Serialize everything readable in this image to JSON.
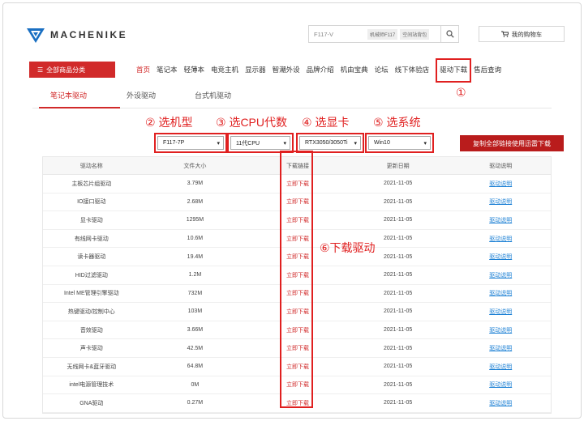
{
  "brand": {
    "name": "MACHENIKE"
  },
  "search": {
    "value": "F117-V",
    "hot_tags": [
      "机械师F117",
      "空间站背包"
    ]
  },
  "cart": {
    "label": "我的购物车"
  },
  "nav": {
    "all_categories": "全部商品分类",
    "items": [
      "首页",
      "笔记本",
      "轻薄本",
      "电竞主机",
      "显示器",
      "智潮外设",
      "品牌介绍",
      "机由宝典",
      "论坛",
      "线下体验店",
      "驱动下载",
      "售后查询"
    ]
  },
  "subtabs": [
    "笔记本驱动",
    "外设驱动",
    "台式机驱动"
  ],
  "annotations": {
    "a1": "①",
    "a2": "② 选机型",
    "a3": "③ 选CPU代数",
    "a4": "④ 选显卡",
    "a5": "⑤ 选系统",
    "a6": "⑥下载驱动"
  },
  "filters": {
    "model": "F117-7P",
    "cpu": "11代CPU",
    "gpu": "RTX3050/3050Ti",
    "os": "Win10"
  },
  "copy_button": "复制全部链接使用迅雷下载",
  "table": {
    "headers": [
      "驱动名称",
      "文件大小",
      "下载链接",
      "更新日期",
      "驱动说明"
    ],
    "rows": [
      {
        "name": "主板芯片组驱动",
        "size": "3.79M",
        "link": "立即下载",
        "date": "2021-11-05",
        "desc": "驱动说明"
      },
      {
        "name": "IO接口驱动",
        "size": "2.68M",
        "link": "立即下载",
        "date": "2021-11-05",
        "desc": "驱动说明"
      },
      {
        "name": "显卡驱动",
        "size": "1295M",
        "link": "立即下载",
        "date": "2021-11-05",
        "desc": "驱动说明"
      },
      {
        "name": "有线网卡驱动",
        "size": "10.6M",
        "link": "立即下载",
        "date": "2021-11-05",
        "desc": "驱动说明"
      },
      {
        "name": "读卡器驱动",
        "size": "19.4M",
        "link": "立即下载",
        "date": "2021-11-05",
        "desc": "驱动说明"
      },
      {
        "name": "HID过滤驱动",
        "size": "1.2M",
        "link": "立即下载",
        "date": "2021-11-05",
        "desc": "驱动说明"
      },
      {
        "name": "Intel ME管理引擎驱动",
        "size": "732M",
        "link": "立即下载",
        "date": "2021-11-05",
        "desc": "驱动说明"
      },
      {
        "name": "热键驱动/控制中心",
        "size": "103M",
        "link": "立即下载",
        "date": "2021-11-05",
        "desc": "驱动说明"
      },
      {
        "name": "音效驱动",
        "size": "3.66M",
        "link": "立即下载",
        "date": "2021-11-05",
        "desc": "驱动说明"
      },
      {
        "name": "声卡驱动",
        "size": "42.5M",
        "link": "立即下载",
        "date": "2021-11-05",
        "desc": "驱动说明"
      },
      {
        "name": "无线网卡&蓝牙驱动",
        "size": "64.8M",
        "link": "立即下载",
        "date": "2021-11-05",
        "desc": "驱动说明"
      },
      {
        "name": "intel电源管理技术",
        "size": "0M",
        "link": "立即下载",
        "date": "2021-11-05",
        "desc": "驱动说明"
      },
      {
        "name": "GNA驱动",
        "size": "0.27M",
        "link": "立即下载",
        "date": "2021-11-05",
        "desc": "驱动说明"
      }
    ]
  },
  "colors": {
    "accent": "#d12a2a",
    "annotation": "#e02020",
    "link": "#1a7fd4"
  }
}
